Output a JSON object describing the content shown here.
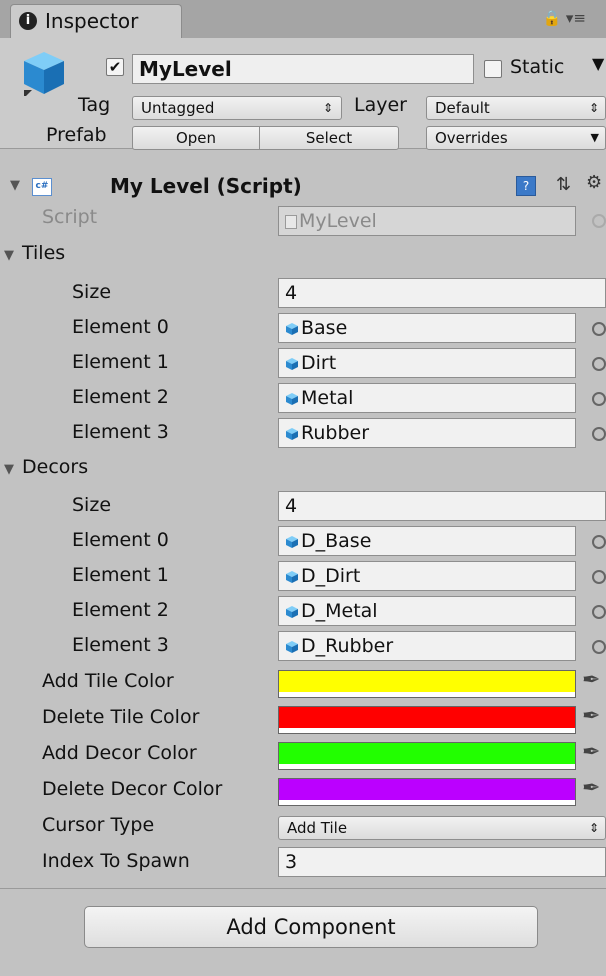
{
  "tab": {
    "title": "Inspector"
  },
  "object": {
    "name": "MyLevel",
    "active_checked": true,
    "static_label": "Static",
    "tag_label": "Tag",
    "tag_value": "Untagged",
    "layer_label": "Layer",
    "layer_value": "Default",
    "prefab_label": "Prefab",
    "prefab_open": "Open",
    "prefab_select": "Select",
    "prefab_overrides": "Overrides"
  },
  "component": {
    "title": "My Level (Script)",
    "script_label": "Script",
    "script_value": "MyLevel"
  },
  "tiles": {
    "label": "Tiles",
    "size_label": "Size",
    "size": "4",
    "elements": [
      {
        "label": "Element 0",
        "value": "Base"
      },
      {
        "label": "Element 1",
        "value": "Dirt"
      },
      {
        "label": "Element 2",
        "value": "Metal"
      },
      {
        "label": "Element 3",
        "value": "Rubber"
      }
    ]
  },
  "decors": {
    "label": "Decors",
    "size_label": "Size",
    "size": "4",
    "elements": [
      {
        "label": "Element 0",
        "value": "D_Base"
      },
      {
        "label": "Element 1",
        "value": "D_Dirt"
      },
      {
        "label": "Element 2",
        "value": "D_Metal"
      },
      {
        "label": "Element 3",
        "value": "D_Rubber"
      }
    ]
  },
  "colors": [
    {
      "label": "Add Tile Color",
      "hex": "#ffff00"
    },
    {
      "label": "Delete Tile Color",
      "hex": "#ff0000"
    },
    {
      "label": "Add Decor Color",
      "hex": "#22ff00"
    },
    {
      "label": "Delete Decor Color",
      "hex": "#bb00ff"
    }
  ],
  "cursor": {
    "label": "Cursor Type",
    "value": "Add Tile"
  },
  "index": {
    "label": "Index To Spawn",
    "value": "3"
  },
  "footer": {
    "add_component": "Add Component"
  }
}
